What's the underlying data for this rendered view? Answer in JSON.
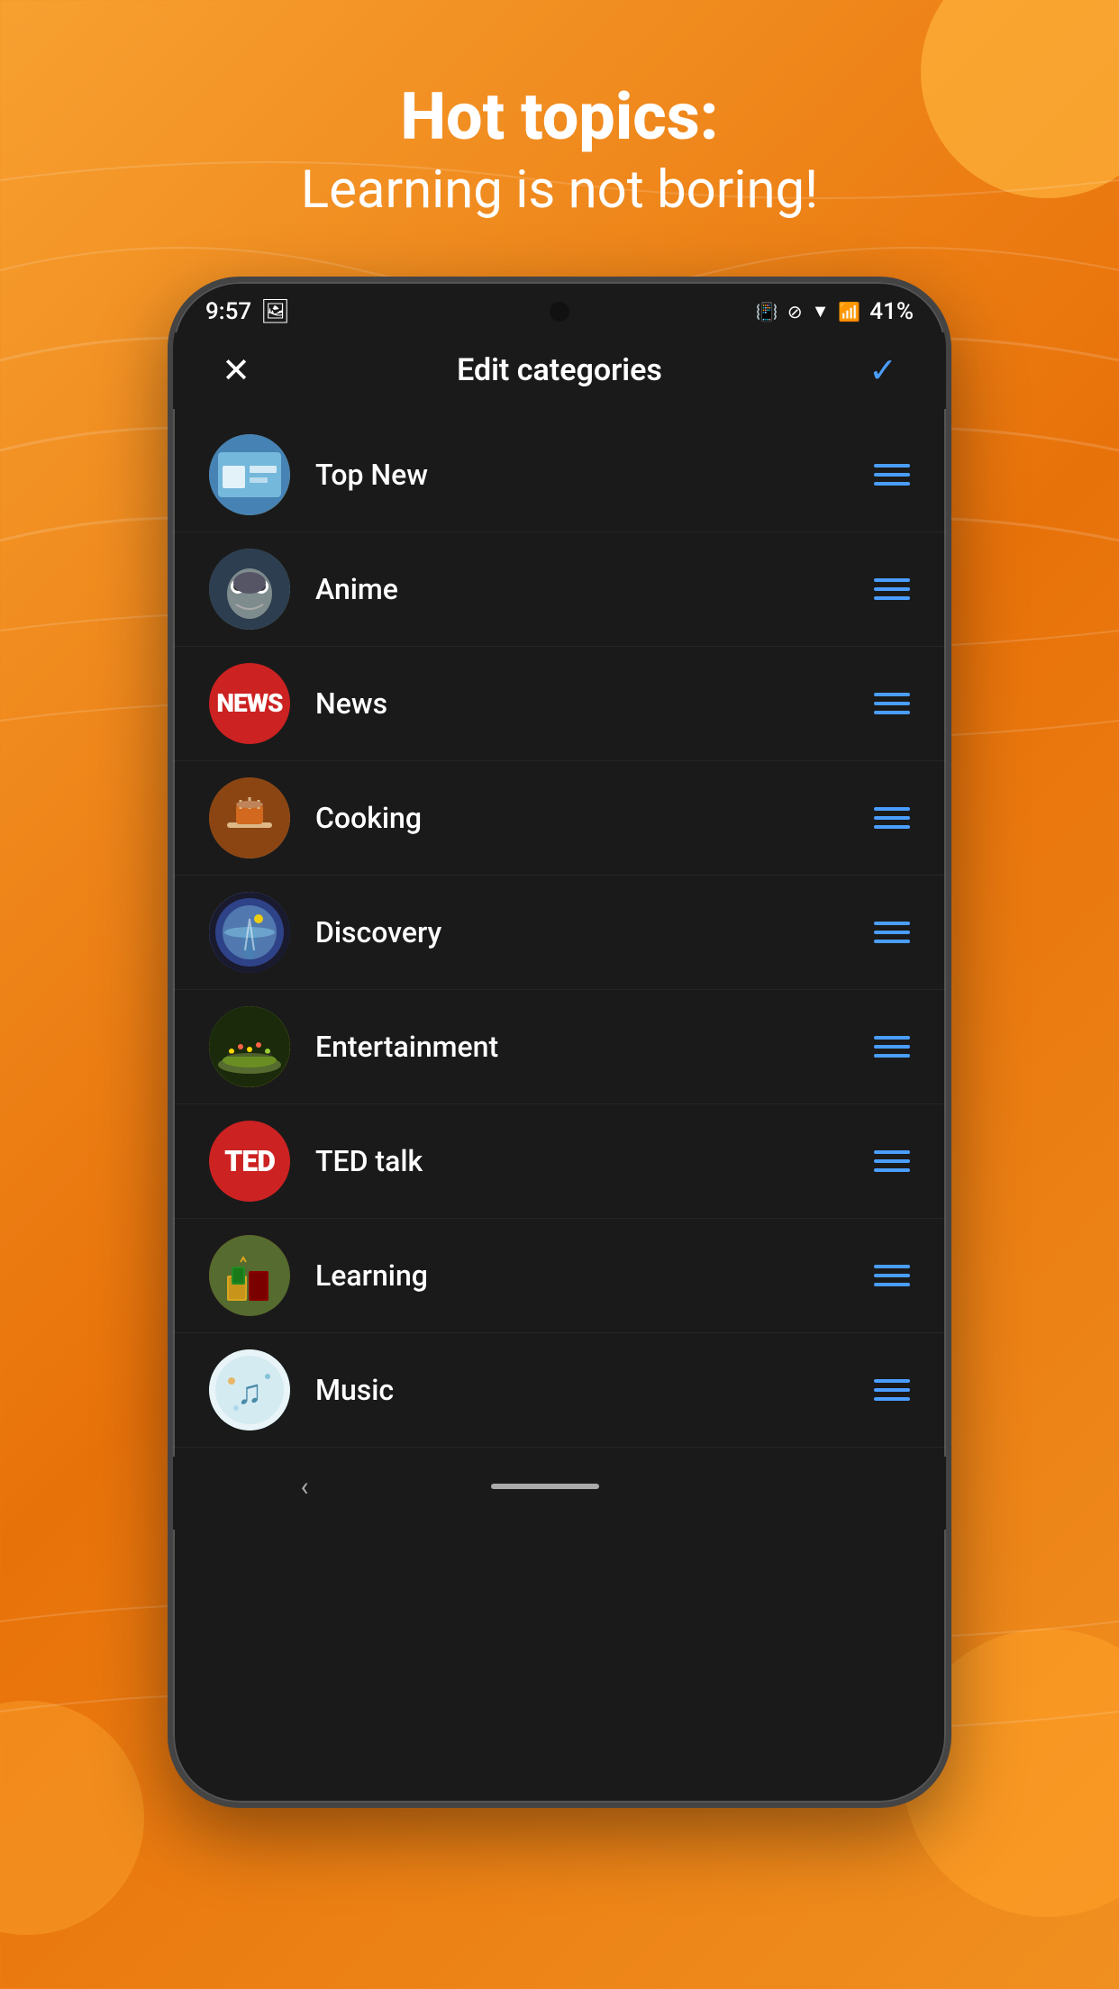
{
  "background": {
    "gradient_start": "#f7a030",
    "gradient_end": "#e8720a"
  },
  "header": {
    "line1": "Hot topics:",
    "line2": "Learning is not boring!"
  },
  "status_bar": {
    "time": "9:57",
    "battery": "41%"
  },
  "app": {
    "title": "Edit categories",
    "close_btn": "✕",
    "confirm_btn": "✓"
  },
  "categories": [
    {
      "id": "topnew",
      "name": "Top New",
      "avatar_class": "avatar-topnew",
      "avatar_text": ""
    },
    {
      "id": "anime",
      "name": "Anime",
      "avatar_class": "avatar-anime",
      "avatar_text": ""
    },
    {
      "id": "news",
      "name": "News",
      "avatar_class": "avatar-news",
      "avatar_text": "NEWS"
    },
    {
      "id": "cooking",
      "name": "Cooking",
      "avatar_class": "avatar-cooking",
      "avatar_text": ""
    },
    {
      "id": "discovery",
      "name": "Discovery",
      "avatar_class": "avatar-discovery",
      "avatar_text": ""
    },
    {
      "id": "entertainment",
      "name": "Entertainment",
      "avatar_class": "avatar-entertainment",
      "avatar_text": ""
    },
    {
      "id": "ted",
      "name": "TED talk",
      "avatar_class": "avatar-ted",
      "avatar_text": "TED"
    },
    {
      "id": "learning",
      "name": "Learning",
      "avatar_class": "avatar-learning",
      "avatar_text": ""
    },
    {
      "id": "music",
      "name": "Music",
      "avatar_class": "avatar-music",
      "avatar_text": ""
    }
  ]
}
